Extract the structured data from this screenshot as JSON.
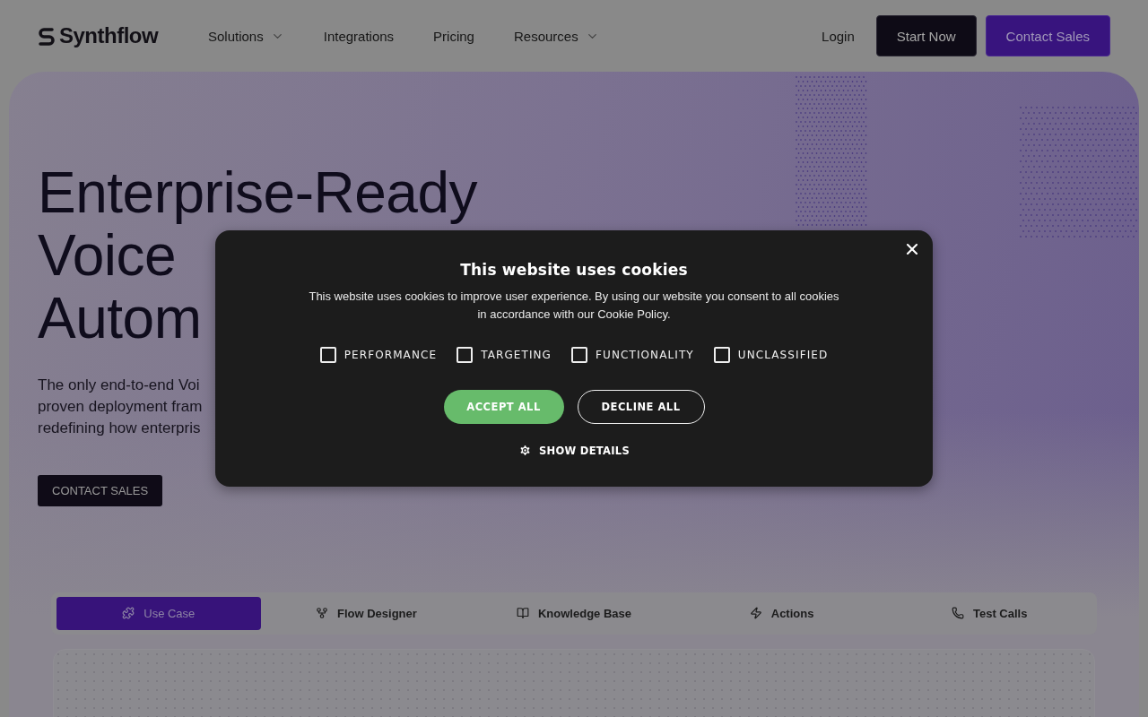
{
  "header": {
    "logo": "Synthflow",
    "nav": [
      {
        "label": "Solutions",
        "kind": "dropdown"
      },
      {
        "label": "Integrations",
        "kind": "link"
      },
      {
        "label": "Pricing",
        "kind": "link"
      },
      {
        "label": "Resources",
        "kind": "dropdown"
      }
    ],
    "login": "Login",
    "start_button": "Start Now",
    "contact_button": "Contact Sales"
  },
  "hero": {
    "title_lines": [
      "Enterprise-Ready",
      "Voice",
      "Autom"
    ],
    "subtitle_lines": [
      "The only end-to-end Voi",
      "proven deployment fram",
      "redefining how enterpris"
    ],
    "cta": "CONTACT SALES"
  },
  "tabs": [
    {
      "label": "Use Case",
      "selected": true
    },
    {
      "label": "Flow Designer",
      "selected": false
    },
    {
      "label": "Knowledge Base",
      "selected": false
    },
    {
      "label": "Actions",
      "selected": false
    },
    {
      "label": "Test Calls",
      "selected": false
    }
  ],
  "cookie_dialog": {
    "title": "This website uses cookies",
    "body": "This website uses cookies to improve user experience. By using our website you consent to all cookies in accordance with our Cookie Policy.",
    "options": [
      {
        "label": "PERFORMANCE",
        "checked": false
      },
      {
        "label": "TARGETING",
        "checked": false
      },
      {
        "label": "FUNCTIONALITY",
        "checked": false
      },
      {
        "label": "UNCLASSIFIED",
        "checked": false
      }
    ],
    "accept": "ACCEPT ALL",
    "decline": "DECLINE ALL",
    "details": "SHOW DETAILS"
  }
}
